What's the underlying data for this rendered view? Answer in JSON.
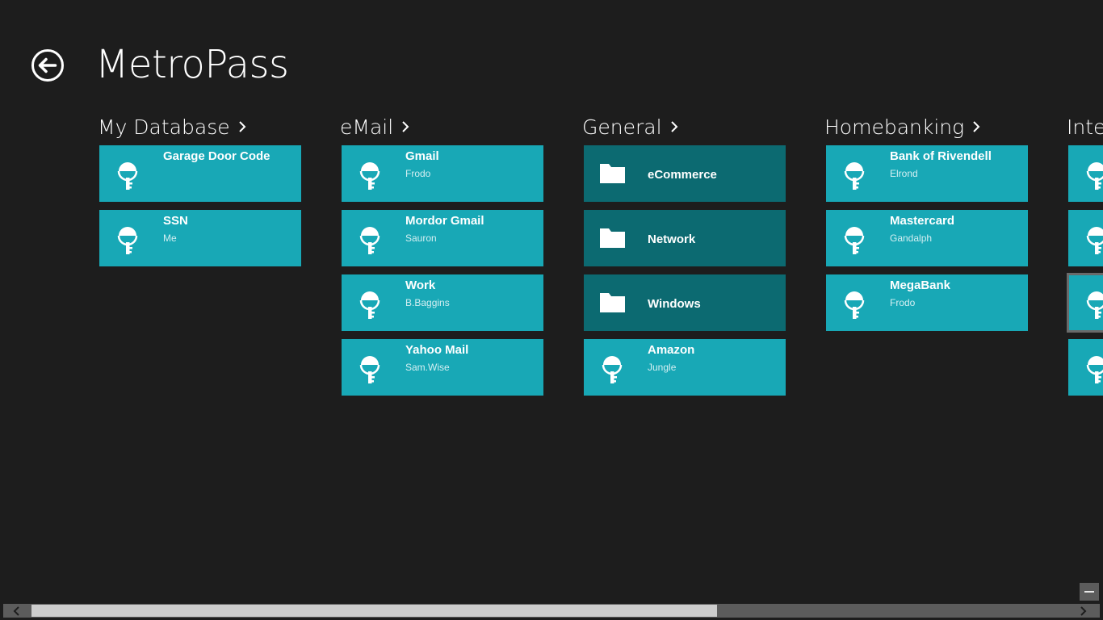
{
  "app": {
    "title": "MetroPass"
  },
  "colors": {
    "background": "#1d1d1d",
    "entry_tile": "#18a8b6",
    "folder_tile": "#0c6a71",
    "scrollbar_track": "#5c5c5c",
    "scrollbar_thumb": "#cdcdcd"
  },
  "icons": {
    "back": "back-arrow-circle-icon",
    "entry": "key-icon",
    "folder": "folder-icon",
    "group_header": "chevron-right-icon"
  },
  "groups": [
    {
      "header": "My Database",
      "tiles": [
        {
          "kind": "entry",
          "name": "Garage Door Code",
          "subtitle": ""
        },
        {
          "kind": "entry",
          "name": "SSN",
          "subtitle": "Me"
        }
      ]
    },
    {
      "header": "eMail",
      "tiles": [
        {
          "kind": "entry",
          "name": "Gmail",
          "subtitle": "Frodo"
        },
        {
          "kind": "entry",
          "name": "Mordor Gmail",
          "subtitle": "Sauron"
        },
        {
          "kind": "entry",
          "name": "Work",
          "subtitle": "B.Baggins"
        },
        {
          "kind": "entry",
          "name": "Yahoo Mail",
          "subtitle": "Sam.Wise"
        }
      ]
    },
    {
      "header": "General",
      "tiles": [
        {
          "kind": "folder",
          "name": "eCommerce",
          "subtitle": ""
        },
        {
          "kind": "folder",
          "name": "Network",
          "subtitle": ""
        },
        {
          "kind": "folder",
          "name": "Windows",
          "subtitle": ""
        },
        {
          "kind": "entry",
          "name": "Amazon",
          "subtitle": "Jungle"
        }
      ]
    },
    {
      "header": "Homebanking",
      "tiles": [
        {
          "kind": "entry",
          "name": "Bank of Rivendell",
          "subtitle": "Elrond"
        },
        {
          "kind": "entry",
          "name": "Mastercard",
          "subtitle": "Gandalph"
        },
        {
          "kind": "entry",
          "name": "MegaBank",
          "subtitle": "Frodo"
        }
      ]
    },
    {
      "header": "Inte",
      "tiles": [
        {
          "kind": "entry",
          "name": "",
          "subtitle": ""
        },
        {
          "kind": "entry",
          "name": "",
          "subtitle": ""
        },
        {
          "kind": "entry",
          "name": "",
          "subtitle": "",
          "focused": true
        },
        {
          "kind": "entry",
          "name": "",
          "subtitle": ""
        }
      ]
    }
  ],
  "scrollbar": {
    "scroll_fraction": 0.0,
    "visible_fraction": 0.66
  }
}
